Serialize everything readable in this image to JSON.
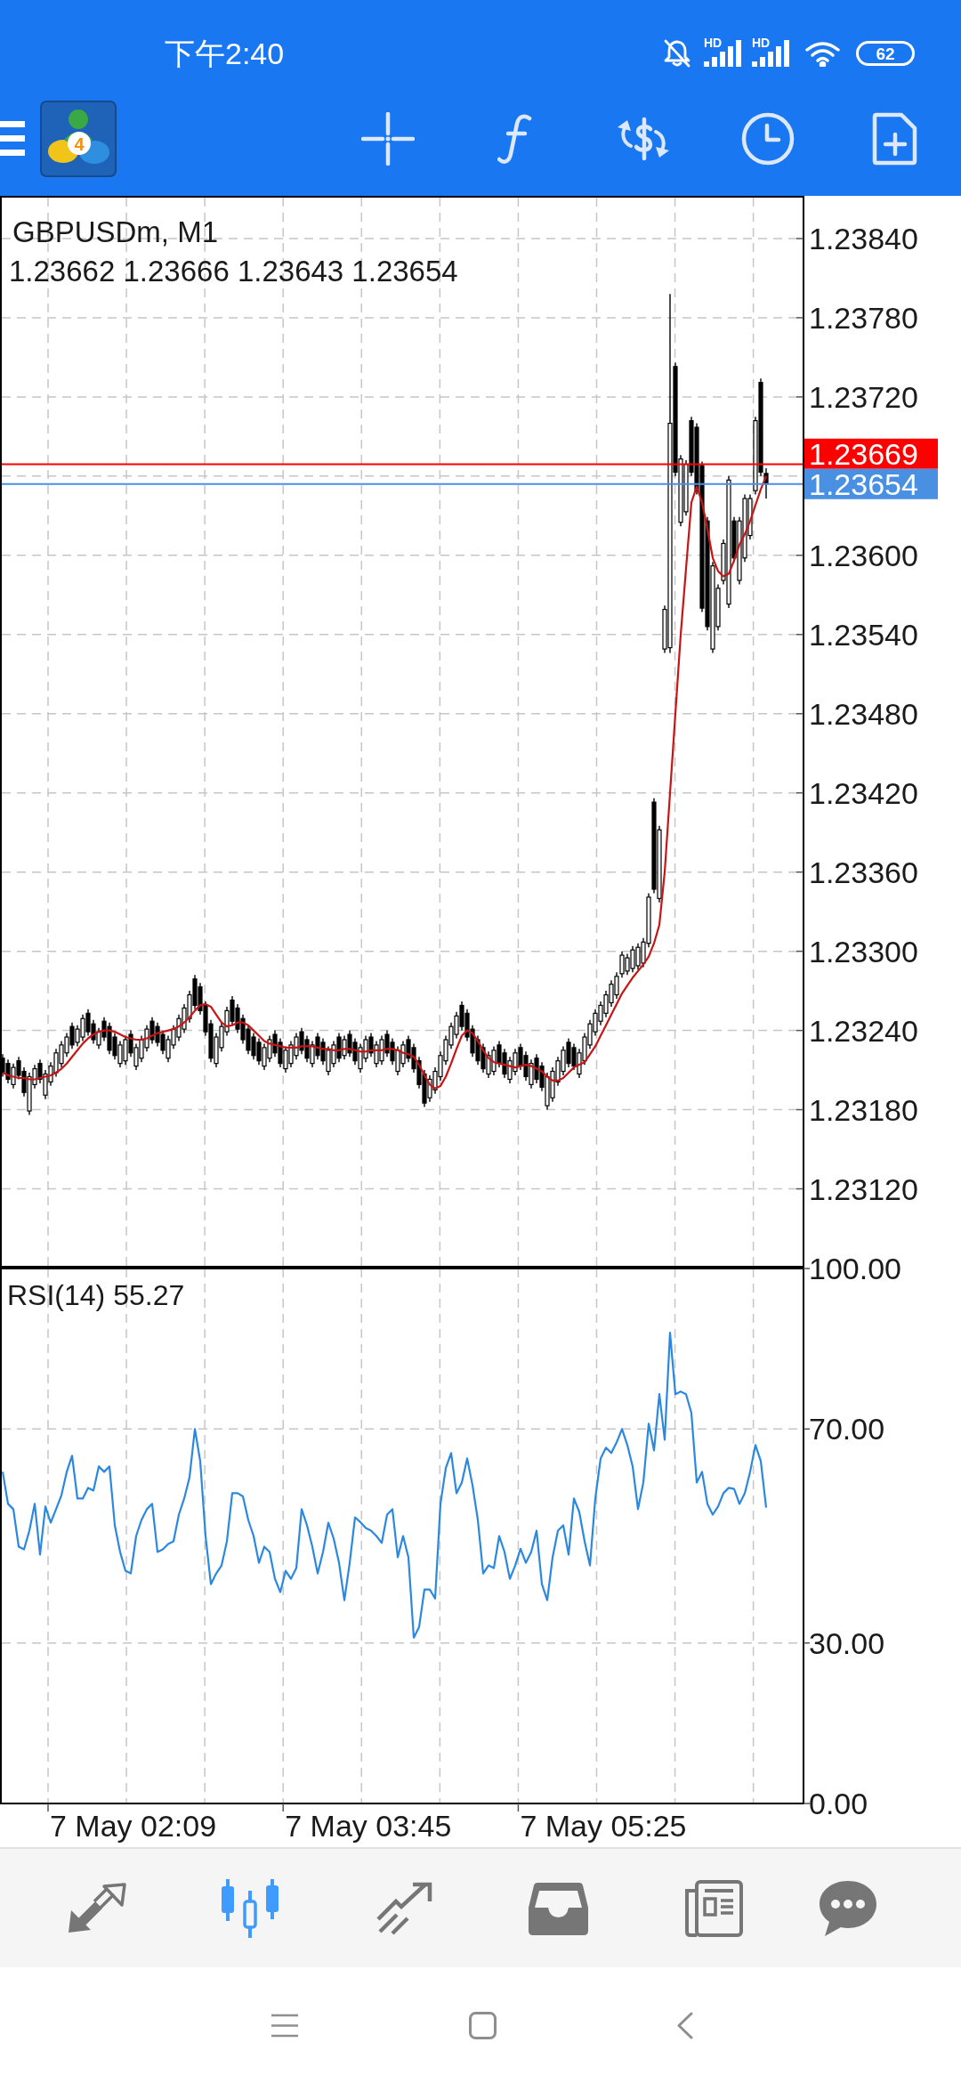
{
  "status_bar": {
    "time": "下午2:40",
    "signals": [
      {
        "badge": "HD"
      },
      {
        "badge": "HD"
      }
    ],
    "battery": "62"
  },
  "toolbar": {
    "logo_badge": "4"
  },
  "price_chart": {
    "ohlc": "1.23662 1.23666 1.23643 1.23654",
    "chart_data": {
      "type": "candlestick",
      "title": "GBPUSDm, M1",
      "grid": true,
      "ylim": [
        1.23061,
        1.23871
      ],
      "yticks": [
        {
          "value": 1.2384,
          "label": "1.23840"
        },
        {
          "value": 1.2378,
          "label": "1.23780"
        },
        {
          "value": 1.2372,
          "label": "1.23720"
        },
        {
          "value": 1.236,
          "label": "1.23600"
        },
        {
          "value": 1.2354,
          "label": "1.23540"
        },
        {
          "value": 1.2348,
          "label": "1.23480"
        },
        {
          "value": 1.2342,
          "label": "1.23420"
        },
        {
          "value": 1.2336,
          "label": "1.23360"
        },
        {
          "value": 1.233,
          "label": "1.23300"
        },
        {
          "value": 1.2324,
          "label": "1.23240"
        },
        {
          "value": 1.2318,
          "label": "1.23180"
        },
        {
          "value": 1.2312,
          "label": "1.23120"
        }
      ],
      "ohlc": [
        [
          1.23219,
          1.23222,
          1.23205,
          1.23208
        ],
        [
          1.23215,
          1.23218,
          1.232,
          1.23203
        ],
        [
          1.23199,
          1.23215,
          1.23196,
          1.23212
        ],
        [
          1.23217,
          1.2322,
          1.23203,
          1.23206
        ],
        [
          1.23209,
          1.23212,
          1.2319,
          1.23193
        ],
        [
          1.23179,
          1.23208,
          1.23176,
          1.23205
        ],
        [
          1.23199,
          1.23214,
          1.23196,
          1.23211
        ],
        [
          1.23215,
          1.23218,
          1.232,
          1.23203
        ],
        [
          1.23191,
          1.2321,
          1.23188,
          1.23207
        ],
        [
          1.23201,
          1.23216,
          1.23198,
          1.23213
        ],
        [
          1.23208,
          1.23226,
          1.23205,
          1.23223
        ],
        [
          1.23215,
          1.23232,
          1.23212,
          1.23229
        ],
        [
          1.23223,
          1.23238,
          1.2322,
          1.23235
        ],
        [
          1.23243,
          1.23246,
          1.23226,
          1.23229
        ],
        [
          1.23231,
          1.23244,
          1.23228,
          1.23241
        ],
        [
          1.23235,
          1.23252,
          1.23232,
          1.23249
        ],
        [
          1.23253,
          1.23256,
          1.23236,
          1.23239
        ],
        [
          1.23245,
          1.23248,
          1.2323,
          1.23233
        ],
        [
          1.23229,
          1.23242,
          1.23226,
          1.23239
        ],
        [
          1.23247,
          1.2325,
          1.23232,
          1.23235
        ],
        [
          1.23243,
          1.23246,
          1.23222,
          1.23225
        ],
        [
          1.23235,
          1.23238,
          1.23218,
          1.23221
        ],
        [
          1.23215,
          1.23232,
          1.23212,
          1.23229
        ],
        [
          1.23217,
          1.23236,
          1.23214,
          1.23233
        ],
        [
          1.23237,
          1.2324,
          1.2322,
          1.23223
        ],
        [
          1.23213,
          1.2323,
          1.2321,
          1.23227
        ],
        [
          1.23219,
          1.23236,
          1.23216,
          1.23233
        ],
        [
          1.23227,
          1.23244,
          1.23224,
          1.23241
        ],
        [
          1.23247,
          1.2325,
          1.2323,
          1.23233
        ],
        [
          1.23243,
          1.23246,
          1.23228,
          1.23231
        ],
        [
          1.23237,
          1.2324,
          1.23222,
          1.23225
        ],
        [
          1.23219,
          1.23236,
          1.23216,
          1.23233
        ],
        [
          1.23229,
          1.23244,
          1.23226,
          1.23241
        ],
        [
          1.23235,
          1.23252,
          1.23232,
          1.23249
        ],
        [
          1.23241,
          1.2326,
          1.23238,
          1.23257
        ],
        [
          1.23249,
          1.2327,
          1.23246,
          1.23267
        ],
        [
          1.23279,
          1.23282,
          1.23256,
          1.23259
        ],
        [
          1.23273,
          1.23276,
          1.23252,
          1.23255
        ],
        [
          1.23259,
          1.23262,
          1.23236,
          1.23239
        ],
        [
          1.23245,
          1.23248,
          1.23216,
          1.23219
        ],
        [
          1.23215,
          1.23238,
          1.23212,
          1.23235
        ],
        [
          1.23227,
          1.23246,
          1.23224,
          1.23243
        ],
        [
          1.23239,
          1.23258,
          1.23236,
          1.23255
        ],
        [
          1.23263,
          1.23266,
          1.23244,
          1.23247
        ],
        [
          1.23257,
          1.2326,
          1.23238,
          1.23241
        ],
        [
          1.23249,
          1.23252,
          1.2323,
          1.23233
        ],
        [
          1.23241,
          1.23244,
          1.23222,
          1.23225
        ],
        [
          1.23235,
          1.23238,
          1.23218,
          1.23221
        ],
        [
          1.23231,
          1.23234,
          1.23214,
          1.23217
        ],
        [
          1.23213,
          1.2323,
          1.2321,
          1.23227
        ],
        [
          1.23219,
          1.23236,
          1.23216,
          1.23233
        ],
        [
          1.23237,
          1.2324,
          1.2322,
          1.23223
        ],
        [
          1.23231,
          1.23234,
          1.23212,
          1.23215
        ],
        [
          1.23211,
          1.23228,
          1.23208,
          1.23225
        ],
        [
          1.23215,
          1.23232,
          1.23212,
          1.23229
        ],
        [
          1.23221,
          1.23238,
          1.23218,
          1.23235
        ],
        [
          1.23239,
          1.23242,
          1.23222,
          1.23225
        ],
        [
          1.23233,
          1.23236,
          1.23216,
          1.23219
        ],
        [
          1.23215,
          1.23232,
          1.23212,
          1.23229
        ],
        [
          1.23235,
          1.23238,
          1.23218,
          1.23221
        ],
        [
          1.23231,
          1.23234,
          1.23214,
          1.23217
        ],
        [
          1.23209,
          1.23228,
          1.23206,
          1.23225
        ],
        [
          1.23215,
          1.23232,
          1.23212,
          1.23229
        ],
        [
          1.23235,
          1.23238,
          1.23216,
          1.23219
        ],
        [
          1.23221,
          1.23236,
          1.23218,
          1.23233
        ],
        [
          1.23237,
          1.2324,
          1.2322,
          1.23223
        ],
        [
          1.23231,
          1.23234,
          1.23214,
          1.23217
        ],
        [
          1.23211,
          1.2323,
          1.23208,
          1.23227
        ],
        [
          1.23219,
          1.23236,
          1.23216,
          1.23233
        ],
        [
          1.23235,
          1.23238,
          1.2322,
          1.23223
        ],
        [
          1.23215,
          1.23232,
          1.23212,
          1.23229
        ],
        [
          1.23217,
          1.23236,
          1.23214,
          1.23233
        ],
        [
          1.23237,
          1.2324,
          1.2322,
          1.23223
        ],
        [
          1.23231,
          1.23234,
          1.23214,
          1.23217
        ],
        [
          1.23209,
          1.23228,
          1.23206,
          1.23225
        ],
        [
          1.23215,
          1.23232,
          1.23212,
          1.23229
        ],
        [
          1.23233,
          1.23236,
          1.23216,
          1.23219
        ],
        [
          1.23227,
          1.2323,
          1.23208,
          1.23211
        ],
        [
          1.23217,
          1.2322,
          1.23196,
          1.23199
        ],
        [
          1.23207,
          1.2321,
          1.23182,
          1.23185
        ],
        [
          1.23189,
          1.23206,
          1.23186,
          1.23203
        ],
        [
          1.23195,
          1.23212,
          1.23192,
          1.23209
        ],
        [
          1.23205,
          1.23224,
          1.23202,
          1.23221
        ],
        [
          1.23217,
          1.23236,
          1.23214,
          1.23233
        ],
        [
          1.23229,
          1.23246,
          1.23226,
          1.23243
        ],
        [
          1.23237,
          1.23254,
          1.23234,
          1.23251
        ],
        [
          1.23259,
          1.23262,
          1.2324,
          1.23243
        ],
        [
          1.23253,
          1.23256,
          1.23232,
          1.23235
        ],
        [
          1.23241,
          1.23244,
          1.2322,
          1.23223
        ],
        [
          1.23233,
          1.23236,
          1.23214,
          1.23217
        ],
        [
          1.23227,
          1.2323,
          1.23208,
          1.23211
        ],
        [
          1.23207,
          1.23224,
          1.23204,
          1.23221
        ],
        [
          1.23209,
          1.23228,
          1.23206,
          1.23225
        ],
        [
          1.23229,
          1.23232,
          1.23212,
          1.23215
        ],
        [
          1.23223,
          1.23226,
          1.23204,
          1.23207
        ],
        [
          1.23203,
          1.2322,
          1.232,
          1.23217
        ],
        [
          1.23209,
          1.23226,
          1.23206,
          1.23223
        ],
        [
          1.23227,
          1.2323,
          1.2321,
          1.23213
        ],
        [
          1.23221,
          1.23224,
          1.23202,
          1.23205
        ],
        [
          1.23199,
          1.23218,
          1.23196,
          1.23215
        ],
        [
          1.23219,
          1.23222,
          1.232,
          1.23203
        ],
        [
          1.23213,
          1.23216,
          1.23194,
          1.23197
        ],
        [
          1.23183,
          1.23208,
          1.2318,
          1.23205
        ],
        [
          1.23189,
          1.23212,
          1.23186,
          1.23209
        ],
        [
          1.23201,
          1.2322,
          1.23198,
          1.23217
        ],
        [
          1.23209,
          1.23228,
          1.23206,
          1.23225
        ],
        [
          1.23231,
          1.23234,
          1.23212,
          1.23215
        ],
        [
          1.23227,
          1.2323,
          1.2321,
          1.23213
        ],
        [
          1.23207,
          1.23226,
          1.23204,
          1.23223
        ],
        [
          1.23217,
          1.23238,
          1.23214,
          1.23235
        ],
        [
          1.23229,
          1.23248,
          1.23226,
          1.23245
        ],
        [
          1.23239,
          1.23256,
          1.23236,
          1.23253
        ],
        [
          1.23247,
          1.23262,
          1.23244,
          1.23259
        ],
        [
          1.23253,
          1.2327,
          1.2325,
          1.23267
        ],
        [
          1.23261,
          1.23278,
          1.23258,
          1.23275
        ],
        [
          1.23267,
          1.23284,
          1.23264,
          1.23281
        ],
        [
          1.23283,
          1.233,
          1.2328,
          1.23297
        ],
        [
          1.23285,
          1.23298,
          1.23282,
          1.23295
        ],
        [
          1.23287,
          1.23304,
          1.23284,
          1.23301
        ],
        [
          1.23289,
          1.23306,
          1.23286,
          1.23303
        ],
        [
          1.23291,
          1.2331,
          1.23288,
          1.23307
        ],
        [
          1.23306,
          1.23344,
          1.23303,
          1.23341
        ],
        [
          1.23413,
          1.23416,
          1.23344,
          1.23347
        ],
        [
          1.2334,
          1.23395,
          1.23337,
          1.23392
        ],
        [
          1.23529,
          1.23562,
          1.23526,
          1.23559
        ],
        [
          1.2353,
          1.23798,
          1.23526,
          1.237
        ],
        [
          1.23743,
          1.23746,
          1.2366,
          1.23663
        ],
        [
          1.23625,
          1.23676,
          1.23622,
          1.23673
        ],
        [
          1.23633,
          1.23672,
          1.2363,
          1.23669
        ],
        [
          1.23702,
          1.23705,
          1.2366,
          1.23663
        ],
        [
          1.23697,
          1.237,
          1.23646,
          1.23649
        ],
        [
          1.23668,
          1.23671,
          1.23557,
          1.2356
        ],
        [
          1.23626,
          1.23629,
          1.23543,
          1.23546
        ],
        [
          1.23529,
          1.23595,
          1.23526,
          1.23592
        ],
        [
          1.23546,
          1.23578,
          1.23543,
          1.23575
        ],
        [
          1.23581,
          1.23612,
          1.23578,
          1.23609
        ],
        [
          1.23563,
          1.2366,
          1.2356,
          1.23657
        ],
        [
          1.23626,
          1.23629,
          1.23595,
          1.23598
        ],
        [
          1.23581,
          1.23629,
          1.23578,
          1.23626
        ],
        [
          1.23598,
          1.23646,
          1.23595,
          1.23643
        ],
        [
          1.23615,
          1.23646,
          1.23612,
          1.23643
        ],
        [
          1.23649,
          1.23705,
          1.23646,
          1.23702
        ],
        [
          1.23731,
          1.23734,
          1.2366,
          1.23663
        ],
        [
          1.23662,
          1.23666,
          1.23643,
          1.23654
        ]
      ],
      "series": [
        {
          "type": "line",
          "color": "#c81414",
          "values": [
            1.23208,
            1.23206,
            1.23205,
            1.23204,
            1.23204,
            1.23203,
            1.23203,
            1.23204,
            1.23205,
            1.23206,
            1.23208,
            1.23211,
            1.23215,
            1.2322,
            1.23225,
            1.2323,
            1.23234,
            1.23237,
            1.23239,
            1.2324,
            1.2324,
            1.23239,
            1.23237,
            1.23235,
            1.23234,
            1.23233,
            1.23233,
            1.23234,
            1.23236,
            1.23238,
            1.23239,
            1.2324,
            1.23241,
            1.23243,
            1.23246,
            1.2325,
            1.23255,
            1.23259,
            1.2326,
            1.23258,
            1.23252,
            1.23246,
            1.23243,
            1.23244,
            1.23246,
            1.23246,
            1.23244,
            1.2324,
            1.23236,
            1.23232,
            1.2323,
            1.23229,
            1.23228,
            1.23227,
            1.23227,
            1.23227,
            1.23228,
            1.23228,
            1.23228,
            1.23227,
            1.23226,
            1.23226,
            1.23225,
            1.23225,
            1.23226,
            1.23226,
            1.23225,
            1.23224,
            1.23224,
            1.23225,
            1.23225,
            1.23225,
            1.23226,
            1.23226,
            1.23225,
            1.23223,
            1.23222,
            1.2322,
            1.23214,
            1.23206,
            1.23199,
            1.23196,
            1.23198,
            1.23205,
            1.23215,
            1.23226,
            1.23236,
            1.2324,
            1.23238,
            1.23232,
            1.23225,
            1.23219,
            1.23216,
            1.23215,
            1.23214,
            1.23213,
            1.23212,
            1.23213,
            1.23214,
            1.23213,
            1.23211,
            1.23209,
            1.23205,
            1.23202,
            1.23202,
            1.23204,
            1.23208,
            1.23212,
            1.23214,
            1.23216,
            1.23222,
            1.23228,
            1.23236,
            1.23244,
            1.23252,
            1.2326,
            1.23268,
            1.23274,
            1.2328,
            1.23285,
            1.2329,
            1.23296,
            1.23306,
            1.2332,
            1.2336,
            1.2342,
            1.2348,
            1.2354,
            1.2359,
            1.2364,
            1.23652,
            1.2364,
            1.2362,
            1.23598,
            1.23588,
            1.23584,
            1.23586,
            1.23596,
            1.23608,
            1.23616,
            1.23626,
            1.23638,
            1.2365,
            1.2366
          ]
        }
      ],
      "ref_lines": [
        {
          "axis": "y",
          "value": 1.23669,
          "label": "1.23669",
          "color": "#ff0000"
        },
        {
          "axis": "y",
          "value": 1.23654,
          "label": "1.23654",
          "color": "#4a90e2"
        }
      ]
    }
  },
  "rsi_chart": {
    "chart_data": {
      "type": "line",
      "title": "RSI(14) 55.27",
      "grid": true,
      "ylim": [
        0,
        100
      ],
      "yticks": [
        {
          "value": 100,
          "label": "100.00"
        },
        {
          "value": 70,
          "label": "70.00"
        },
        {
          "value": 30,
          "label": "30.00"
        },
        {
          "value": 0,
          "label": "0.00"
        }
      ],
      "series": [
        {
          "color": "#2b88e0",
          "values": [
            62,
            56,
            55,
            48,
            47.5,
            51,
            56,
            46.5,
            55.5,
            52.5,
            55,
            57.6,
            62,
            65,
            57,
            57,
            59,
            58.5,
            63,
            62,
            63,
            52,
            47,
            43.5,
            43,
            50,
            53,
            55,
            56,
            47,
            47.5,
            48.5,
            49,
            54,
            57,
            61,
            70,
            64,
            50,
            41,
            43,
            44.5,
            49,
            58,
            58,
            57.4,
            53,
            50,
            45,
            48,
            47,
            42,
            39.5,
            43.5,
            42,
            44,
            55,
            52,
            48,
            43,
            47,
            52.5,
            49.5,
            45,
            38,
            45,
            53.5,
            52.6,
            51.5,
            51,
            50,
            48.7,
            54,
            55,
            46,
            50,
            46,
            31,
            33,
            40,
            40,
            38.3,
            56,
            62.7,
            65.5,
            58,
            60,
            64.5,
            59.5,
            53,
            43,
            44.5,
            44,
            50,
            47,
            42,
            44.5,
            47.6,
            45,
            47,
            51,
            41,
            38,
            46,
            51,
            52,
            46.5,
            57,
            54.5,
            49,
            44.5,
            57,
            64.5,
            66.5,
            65.5,
            67.5,
            70,
            67,
            63,
            55,
            60,
            71,
            66,
            76.5,
            68,
            88,
            76.5,
            77,
            76.5,
            73,
            60,
            62,
            56,
            54,
            55.5,
            58,
            59,
            58.8,
            56,
            58,
            62,
            67,
            64,
            55.3
          ]
        }
      ]
    },
    "time_labels": [
      "7 May 02:09",
      "7 May 03:45",
      "7 May 05:25"
    ]
  },
  "bottom_nav": [
    {
      "selected": false
    },
    {
      "selected": true
    },
    {
      "selected": false
    },
    {
      "selected": false
    },
    {
      "selected": false
    },
    {
      "selected": false
    }
  ]
}
